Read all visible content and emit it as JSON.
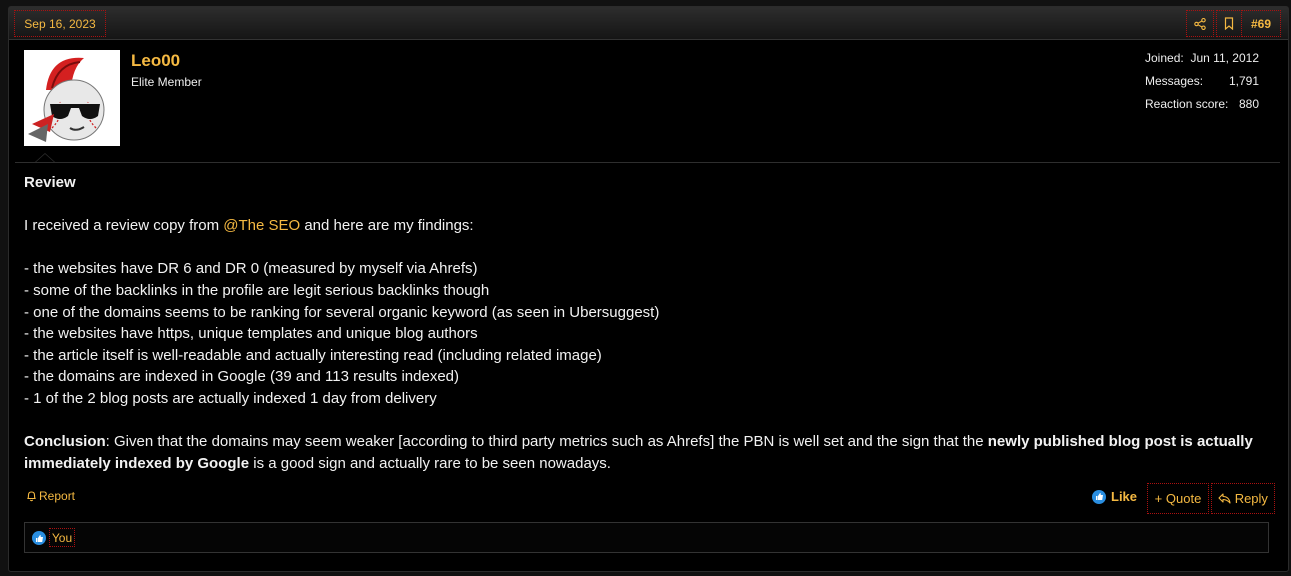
{
  "header": {
    "date": "Sep 16, 2023",
    "post_number": "#69",
    "share_icon": "share-icon",
    "bookmark_icon": "bookmark-icon"
  },
  "user": {
    "name": "Leo00",
    "title": "Elite Member",
    "avatar_icon": "avatar-mohawk-ball-sunglasses",
    "stats": [
      {
        "label": "Joined:",
        "value": "Jun 11, 2012"
      },
      {
        "label": "Messages:",
        "value": "1,791"
      },
      {
        "label": "Reaction score:",
        "value": "880"
      }
    ]
  },
  "post": {
    "heading": "Review",
    "intro_before": "I received a review copy from ",
    "mention": "@The SEO",
    "intro_after": " and here are my findings:",
    "bullets": [
      "- the websites have DR 6 and DR 0 (measured by myself via Ahrefs)",
      "- some of the backlinks in the profile are legit serious backlinks though",
      "- one of the domains seems to be ranking for several organic keyword (as seen in Ubersuggest)",
      "- the websites have https, unique templates and unique blog authors",
      "- the article itself is well-readable and actually interesting read (including related image)",
      "- the domains are indexed in Google (39 and 113 results indexed)",
      "- 1 of the 2 blog posts are actually indexed 1 day from delivery"
    ],
    "conclusion_label": "Conclusion",
    "conclusion_part1": ": Given that the domains may seem weaker [according to third party metrics such as Ahrefs] the PBN is well set and the sign that the ",
    "conclusion_bold": "newly published blog post is actually immediately indexed by Google",
    "conclusion_part2": " is a good sign and actually rare to be seen nowadays."
  },
  "actions": {
    "report": "Report",
    "like": "Like",
    "quote": "Quote",
    "reply": "Reply"
  },
  "reactions": {
    "you": "You"
  },
  "colors": {
    "accent": "#f5b942",
    "background": "#000000",
    "outline": "#aa1111",
    "like_blue": "#2a8ee0"
  }
}
